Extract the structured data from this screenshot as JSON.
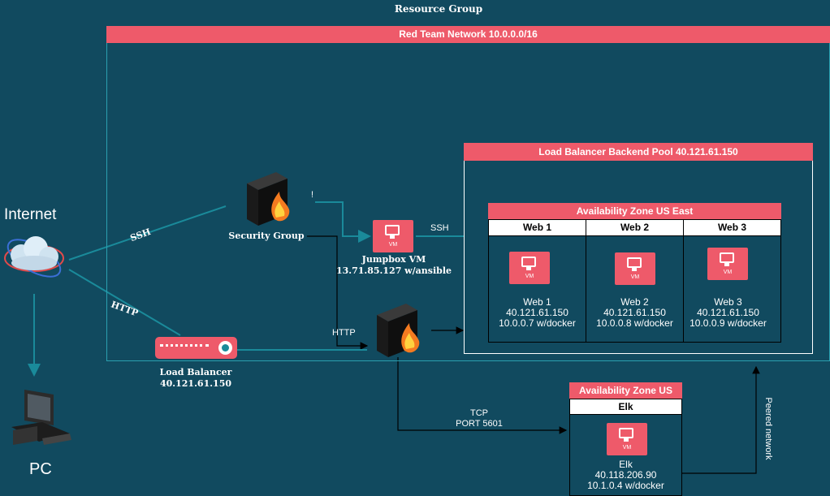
{
  "resource_group": "Resource Group",
  "network": "Red Team Network 10.0.0.0/16",
  "backend_pool": "Load Balancer Backend Pool 40.121.61.150",
  "zone_east": "Availability Zone US East",
  "zone_west": "Availability Zone US West",
  "internet": "Internet",
  "pc": "PC",
  "security_group": "Security Group",
  "jumpbox": {
    "title": "Jumpbox VM",
    "ip": "13.71.85.127 w/ansible"
  },
  "load_balancer": {
    "title": "Load Balancer",
    "ip": "40.121.61.150"
  },
  "vm_icon_label": "VM",
  "web": [
    {
      "header": "Web 1",
      "name": "Web 1",
      "ip": "40.121.61.150",
      "detail": "10.0.0.7 w/docker"
    },
    {
      "header": "Web 2",
      "name": "Web 2",
      "ip": "40.121.61.150",
      "detail": "10.0.0.8 w/docker"
    },
    {
      "header": "Web 3",
      "name": "Web 3",
      "ip": "40.121.61.150",
      "detail": "10.0.0.9 w/docker"
    }
  ],
  "elk": {
    "header": "Elk",
    "name": "Elk",
    "ip": "40.118.206.90",
    "detail": "10.1.0.4 w/docker"
  },
  "edges": {
    "ssh_internet": "SSH",
    "http_internet": "HTTP",
    "ssh_jumpbox": "SSH",
    "http_lb": "HTTP",
    "tcp": "TCP",
    "port": "PORT 5601",
    "peered": "Peered network",
    "tick": "!"
  },
  "colors": {
    "background": "#114a5f",
    "accent": "#ee5a6a",
    "edge": "#1a8a9a"
  }
}
